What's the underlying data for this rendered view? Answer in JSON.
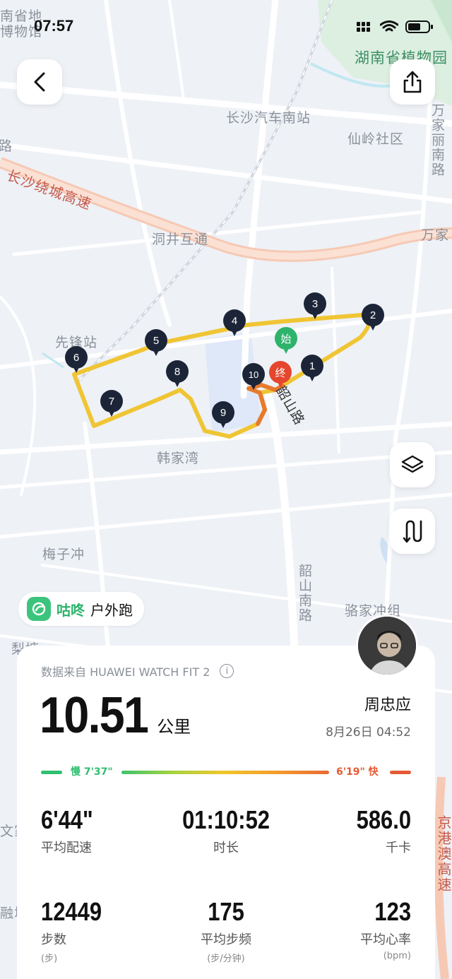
{
  "status": {
    "time": "07:57"
  },
  "map": {
    "labels": {
      "top_left": "南省地\n博物馆",
      "park": "湖南省植物园",
      "station": "长沙汽车南站",
      "community": "仙岭社区",
      "highway": "长沙绕城高速",
      "interchange": "洞井互通",
      "wanjia": "万家",
      "wanjia_road": "万家丽南路",
      "xianfeng": "先锋站",
      "hanjiawan": "韩家湾",
      "meizichong": "梅子冲",
      "shaoshan": "韶山南路",
      "lujiachong": "骆家冲组",
      "road_fragment": "路",
      "route_road": "韶山路",
      "jinggang": "京港澳高速",
      "left_frag1": "梨塘",
      "left_frag2": "文家",
      "left_frag3": "融城",
      "road_left": "路"
    },
    "pins": [
      "1",
      "2",
      "3",
      "4",
      "5",
      "6",
      "7",
      "8",
      "9",
      "10"
    ],
    "start_label": "始",
    "end_label": "终"
  },
  "app_tag": {
    "name": "咕咚",
    "sport": "户外跑"
  },
  "card": {
    "source": "数据来自 HUAWEI WATCH FIT 2",
    "distance": "10.51",
    "distance_unit": "公里",
    "user_name": "周忠应",
    "date_time": "8月26日 04:52",
    "pace_slow": "慢 7'37\"",
    "pace_fast": "6'19\" 快",
    "stats": [
      {
        "value": "6'44\"",
        "label": "平均配速",
        "sub": ""
      },
      {
        "value": "01:10:52",
        "label": "时长",
        "sub": ""
      },
      {
        "value": "586.0",
        "label": "千卡",
        "sub": ""
      },
      {
        "value": "12449",
        "label": "步数",
        "sub": "(步)"
      },
      {
        "value": "175",
        "label": "平均步频",
        "sub": "(步/分钟)"
      },
      {
        "value": "123",
        "label": "平均心率",
        "sub": "(bpm)"
      }
    ]
  },
  "colors": {
    "route": "#f0c534",
    "route_end": "#e77a2c",
    "accent_green": "#2db36a",
    "accent_red": "#e5462e"
  }
}
